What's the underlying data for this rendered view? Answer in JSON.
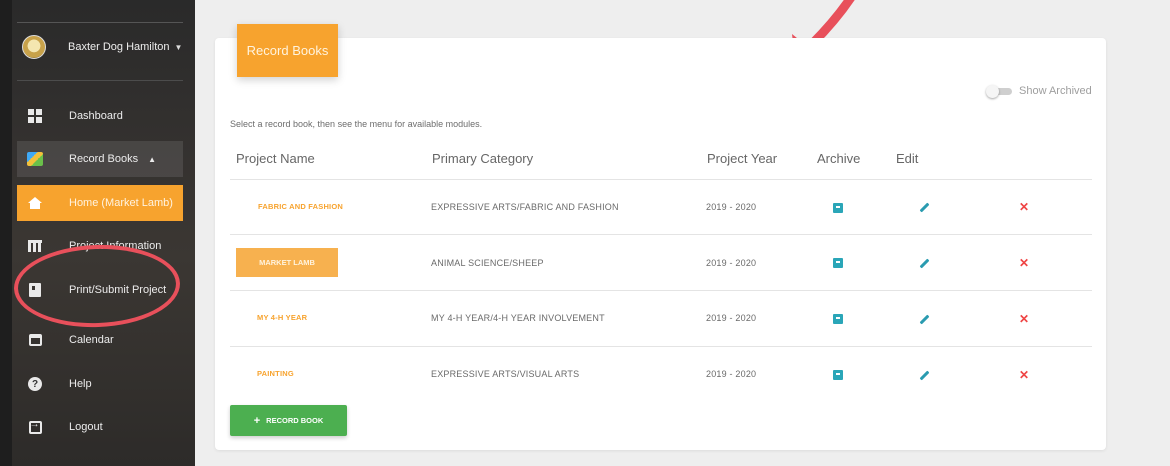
{
  "sidebar": {
    "user_name": "Baxter Dog Hamilton",
    "items": [
      {
        "label": "Dashboard",
        "icon": "dashboard-icon"
      },
      {
        "label": "Record Books",
        "icon": "book-icon"
      },
      {
        "label": "Home (Market Lamb)",
        "icon": "home-icon"
      },
      {
        "label": "Project Information",
        "icon": "table-icon"
      },
      {
        "label": "Print/Submit Project",
        "icon": "print-icon"
      },
      {
        "label": "Calendar",
        "icon": "calendar-icon"
      },
      {
        "label": "Help",
        "icon": "help-icon"
      },
      {
        "label": "Logout",
        "icon": "logout-icon"
      }
    ]
  },
  "card": {
    "header": "Record Books",
    "show_archived_label": "Show Archived",
    "instructions": "Select a record book, then see the menu for available modules.",
    "columns": [
      "Project Name",
      "Primary Category",
      "Project Year",
      "Archive",
      "Edit"
    ],
    "rows": [
      {
        "name": "FABRIC AND FASHION",
        "category": "EXPRESSIVE ARTS/FABRIC AND FASHION",
        "year": "2019 - 2020"
      },
      {
        "name": "MARKET LAMB",
        "category": "ANIMAL SCIENCE/SHEEP",
        "year": "2019 - 2020"
      },
      {
        "name": "MY 4-H YEAR",
        "category": "MY 4-H YEAR/4-H YEAR INVOLVEMENT",
        "year": "2019 - 2020"
      },
      {
        "name": "PAINTING",
        "category": "EXPRESSIVE ARTS/VISUAL ARTS",
        "year": "2019 - 2020"
      }
    ],
    "add_button": "RECORD BOOK"
  },
  "colors": {
    "accent": "#f7a32e",
    "success": "#4caf50",
    "archive": "#2aa6b8",
    "delete": "#ef4444",
    "annotation": "#e8505b"
  }
}
